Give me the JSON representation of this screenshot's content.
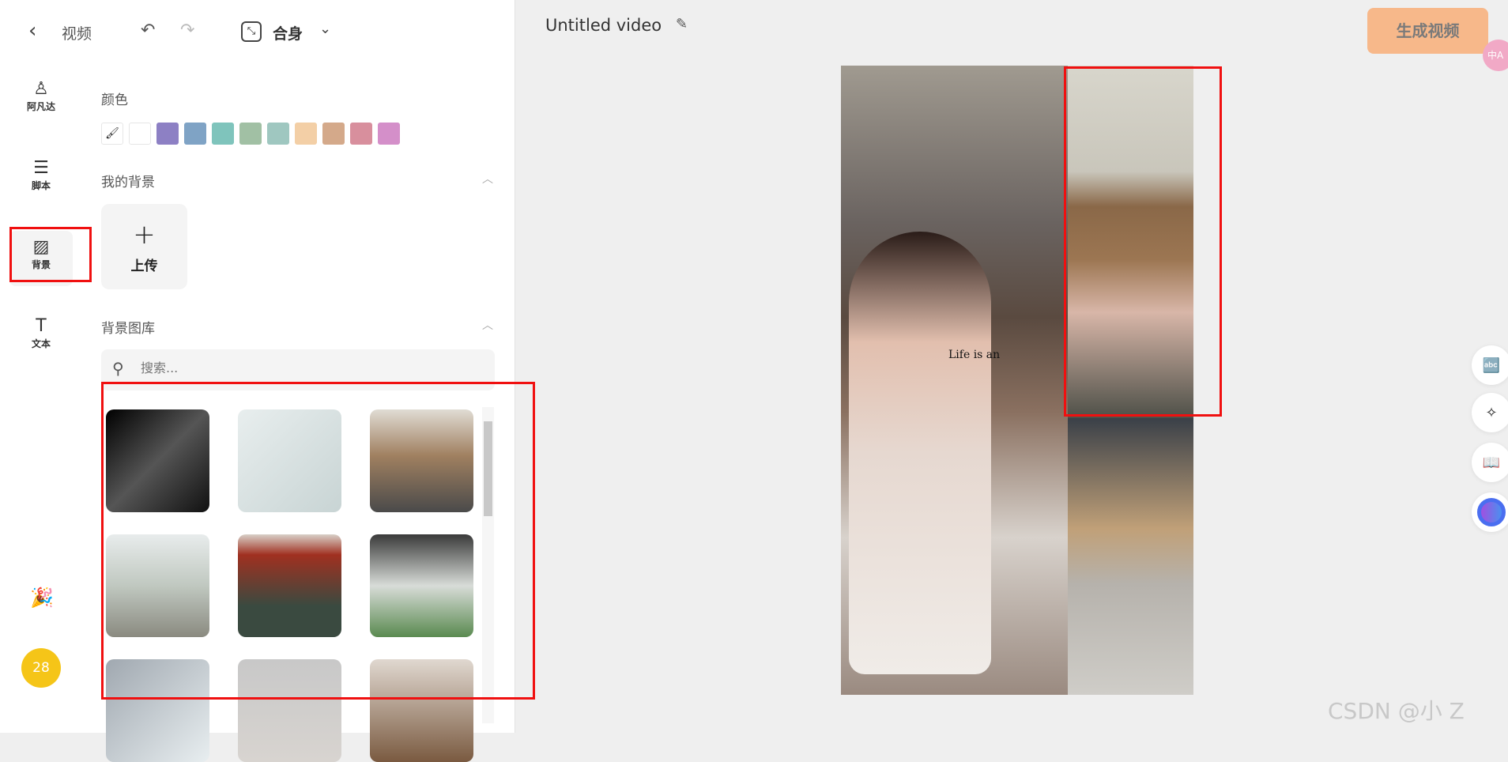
{
  "header": {
    "back_label": "视频",
    "fit_label": "合身"
  },
  "nav": [
    {
      "label": "阿凡达",
      "icon": "person-icon"
    },
    {
      "label": "脚本",
      "icon": "script-icon"
    },
    {
      "label": "背景",
      "icon": "background-icon",
      "active": true
    },
    {
      "label": "文本",
      "icon": "text-icon"
    }
  ],
  "avatar_badge": "28",
  "color_section": {
    "title": "颜色",
    "swatches": [
      "#ffffff",
      "#8d80c4",
      "#7fa3c5",
      "#7fc4bc",
      "#a1c0a4",
      "#9fc7c0",
      "#f3cfa6",
      "#d4a98a",
      "#d88f9d",
      "#d48fc9"
    ]
  },
  "my_backgrounds": {
    "title": "我的背景",
    "upload_label": "上传"
  },
  "library": {
    "title": "背景图库",
    "search_placeholder": "搜索..."
  },
  "editor": {
    "title": "Untitled video",
    "generate_label": "生成视频",
    "generate_color": "#f7b88a",
    "canvas_text": "Life is an"
  },
  "badge": "中A",
  "watermark": "CSDN @小 Z"
}
